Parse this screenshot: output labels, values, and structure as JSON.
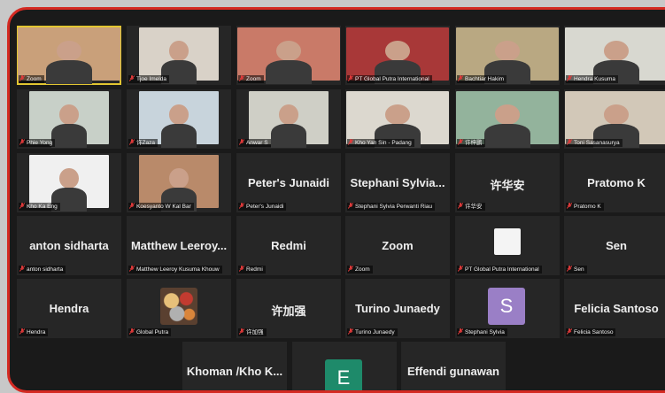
{
  "tiles": [
    {
      "id": "r1c1",
      "caption": "Zoom",
      "kind": "video",
      "bg": "#c9a07a",
      "active": true
    },
    {
      "id": "r1c2",
      "caption": "Tjoe Imelda",
      "kind": "video",
      "bg": "#d9d2c8"
    },
    {
      "id": "r1c3",
      "caption": "Zoom",
      "kind": "video",
      "bg": "#c97a68"
    },
    {
      "id": "r1c4",
      "caption": "PT Global Putra International",
      "kind": "video",
      "bg": "#a83838"
    },
    {
      "id": "r1c5",
      "caption": "Bachtiar Hakim",
      "kind": "video",
      "bg": "#b9a882"
    },
    {
      "id": "r1c6",
      "caption": "Hendra Kusuma",
      "kind": "video",
      "bg": "#d8d8d0"
    },
    {
      "id": "r2c1",
      "caption": "Phie Yong",
      "kind": "video",
      "bg": "#c8d0c8"
    },
    {
      "id": "r2c2",
      "caption": "许Zaza",
      "kind": "video",
      "bg": "#c8d4dc"
    },
    {
      "id": "r2c3",
      "caption": "Anwar S",
      "kind": "video",
      "bg": "#cfcfc6"
    },
    {
      "id": "r2c4",
      "caption": "Kho Yan Sin - Padang",
      "kind": "video",
      "bg": "#dcd8cf"
    },
    {
      "id": "r2c5",
      "caption": "许梓鹏",
      "kind": "video",
      "bg": "#93b39c"
    },
    {
      "id": "r2c6",
      "caption": "Toni Sasanasurya",
      "kind": "video",
      "bg": "#d2c8b8"
    },
    {
      "id": "r3c1",
      "caption": "Kho Ka Eng",
      "kind": "video",
      "bg": "#f0f0f0"
    },
    {
      "id": "r3c2",
      "caption": "Koesyanto W Kal Bar",
      "kind": "video",
      "bg": "#b98a6a"
    },
    {
      "id": "r3c3",
      "caption": "Peter's Junaidi",
      "kind": "name",
      "name": "Peter's Junaidi"
    },
    {
      "id": "r3c4",
      "caption": "Stephani Sylvia Perwanti Riau",
      "kind": "name",
      "name": "Stephani  Sylvia..."
    },
    {
      "id": "r3c5",
      "caption": "许华安",
      "kind": "name",
      "name": "许华安"
    },
    {
      "id": "r3c6",
      "caption": "Pratomo K",
      "kind": "name",
      "name": "Pratomo K"
    },
    {
      "id": "r4c1",
      "caption": "anton sidharta",
      "kind": "name",
      "name": "anton sidharta"
    },
    {
      "id": "r4c2",
      "caption": "Matthew Leeroy Kusuma Khouw",
      "kind": "name",
      "name": "Matthew  Leeroy..."
    },
    {
      "id": "r4c3",
      "caption": "Redmi",
      "kind": "name",
      "name": "Redmi"
    },
    {
      "id": "r4c4",
      "caption": "Zoom",
      "kind": "name",
      "name": "Zoom"
    },
    {
      "id": "r4c5",
      "caption": "PT Global Putra International",
      "kind": "photo"
    },
    {
      "id": "r4c6",
      "caption": "Sen",
      "kind": "name",
      "name": "Sen"
    },
    {
      "id": "r5c1",
      "caption": "Hendra",
      "kind": "name",
      "name": "Hendra"
    },
    {
      "id": "r5c2",
      "caption": "Global Putra",
      "kind": "ornament"
    },
    {
      "id": "r5c3",
      "caption": "许加强",
      "kind": "name",
      "name": "许加强"
    },
    {
      "id": "r5c4",
      "caption": "Turino Junaedy",
      "kind": "name",
      "name": "Turino Junaedy"
    },
    {
      "id": "r5c5",
      "caption": "Stephani Sylvia",
      "kind": "avatar",
      "letter": "S"
    },
    {
      "id": "r5c6",
      "caption": "Felicia Santoso",
      "kind": "name",
      "name": "Felicia Santoso"
    },
    {
      "id": "r6c1",
      "caption": "",
      "kind": "name",
      "name": "Khoman  /Kho K..."
    },
    {
      "id": "r6c2",
      "caption": "",
      "kind": "avatar-e",
      "letter": "E"
    },
    {
      "id": "r6c3",
      "caption": "",
      "kind": "name",
      "name": "Effendi gunawan"
    }
  ],
  "colors": {
    "frame": "#d42a22",
    "active_speaker": "#e2c631",
    "mic_muted": "#e03a3a",
    "tile_bg": "#262626"
  }
}
